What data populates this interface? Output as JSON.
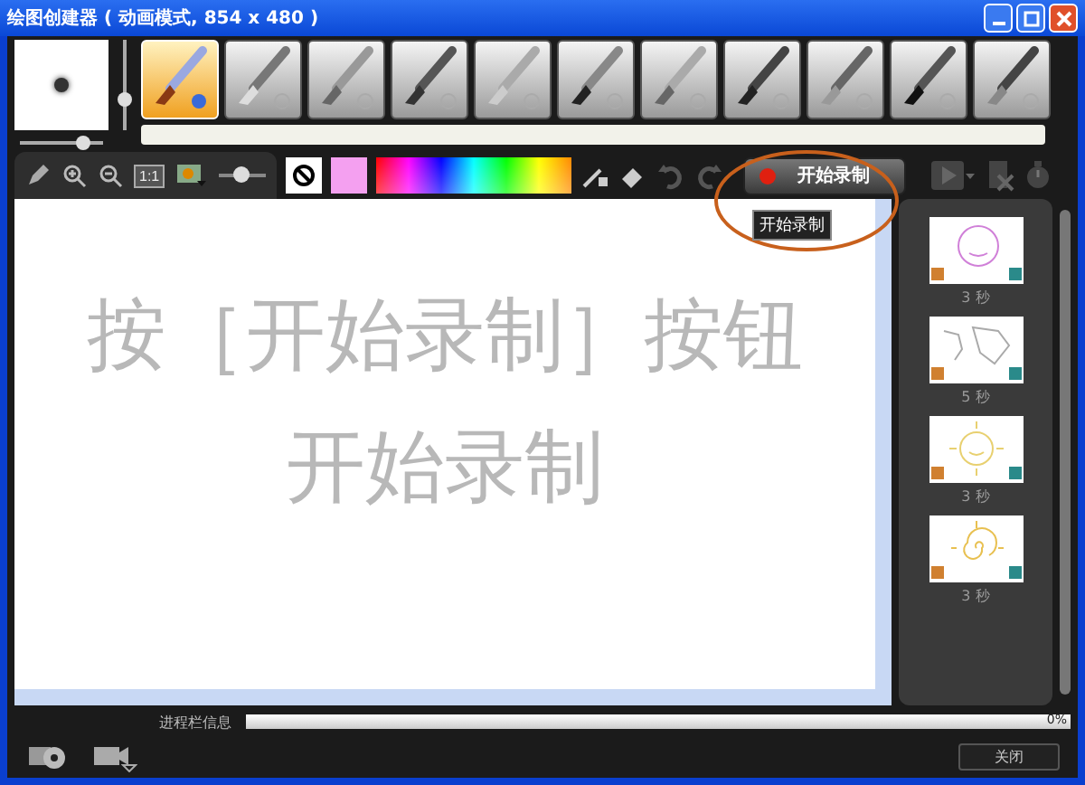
{
  "window": {
    "title": "绘图创建器 ( 动画模式, 854 x 480 )"
  },
  "brush": {
    "size_slider": {
      "level": 0.75
    },
    "opacity_slider": {
      "level": 0.35
    }
  },
  "tools": [
    {
      "kind": "brush",
      "selected": true
    },
    {
      "kind": "airbrush",
      "selected": false
    },
    {
      "kind": "crayon",
      "selected": false
    },
    {
      "kind": "marker",
      "selected": false
    },
    {
      "kind": "chalk",
      "selected": false
    },
    {
      "kind": "pencil",
      "selected": false
    },
    {
      "kind": "highlighter",
      "selected": false
    },
    {
      "kind": "felt",
      "selected": false
    },
    {
      "kind": "stamp",
      "selected": false
    },
    {
      "kind": "paint",
      "selected": false
    },
    {
      "kind": "eraser",
      "selected": false
    }
  ],
  "view": {
    "actual_size_label": "1:1",
    "zoom_slider": {
      "level": 0.45
    }
  },
  "current_color": {
    "color": "#f4a0f0"
  },
  "record_button": {
    "label": "开始录制"
  },
  "tooltip": {
    "text": "开始录制"
  },
  "caption": {
    "lines": [
      "按［开始录制］按钮",
      "开始录制"
    ]
  },
  "frames": [
    {
      "kind": "face",
      "duration": "3 秒"
    },
    {
      "kind": "map",
      "duration": "5 秒"
    },
    {
      "kind": "sun",
      "duration": "3 秒"
    },
    {
      "kind": "spiral",
      "duration": "3 秒"
    }
  ],
  "progress": {
    "label": "进程栏信息",
    "level": 0,
    "reading": "0%"
  },
  "close_button": {
    "label": "关闭"
  }
}
